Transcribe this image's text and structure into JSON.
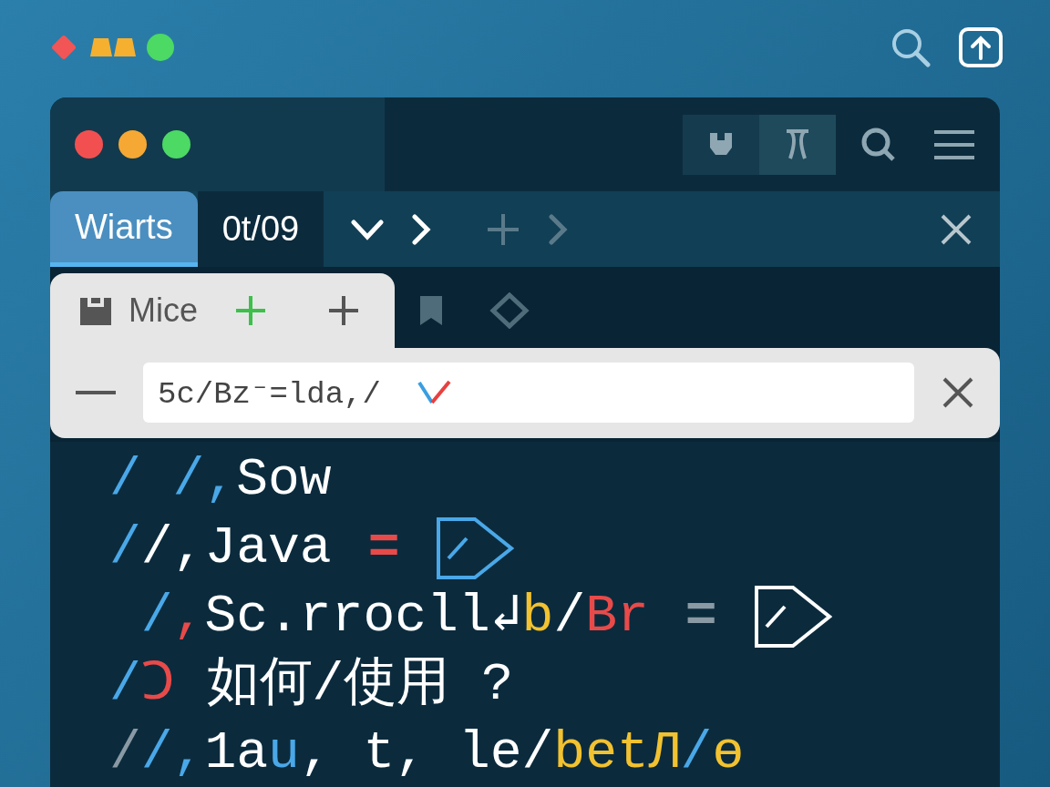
{
  "toolbar_buttons": [
    {
      "selected": false
    },
    {
      "selected": true
    }
  ],
  "tabs": [
    {
      "label": "Wiarts",
      "selected": true
    },
    {
      "label": "0t/09",
      "selected": false
    }
  ],
  "find_panel": {
    "tab_label": "Mice",
    "value": "5c/Bz⁻=lda,/"
  },
  "code_lines": [
    {
      "segments": [
        {
          "text": "/ /,",
          "color": "#4aa8e8"
        },
        {
          "text": "Sow",
          "color": "#ffffff"
        }
      ]
    },
    {
      "segments": [
        {
          "text": "/",
          "color": "#4aa8e8"
        },
        {
          "text": "/,",
          "color": "#ffffff"
        },
        {
          "text": "Java",
          "color": "#ffffff"
        }
      ],
      "equals": {
        "text": "=",
        "color": "#e84a4a"
      },
      "marker": {
        "color": "#4aa8e8"
      }
    },
    {
      "segments": [
        {
          "text": " /",
          "color": "#4aa8e8"
        },
        {
          "text": ",",
          "color": "#e84a4a"
        },
        {
          "text": "Sc.rrocll↲",
          "color": "#ffffff"
        },
        {
          "text": "b",
          "color": "#f2c230"
        },
        {
          "text": "/",
          "color": "#ffffff"
        },
        {
          "text": "Br",
          "color": "#e84a4a"
        }
      ],
      "equals": {
        "text": "=",
        "color": "#8a9aa4"
      },
      "marker": {
        "color": "#ffffff"
      }
    },
    {
      "segments": [
        {
          "text": "/",
          "color": "#4aa8e8"
        },
        {
          "text": "Ↄ",
          "color": "#e84a4a"
        },
        {
          "text": " 如何/使用 ?",
          "color": "#ffffff"
        }
      ]
    },
    {
      "segments": [
        {
          "text": "/",
          "color": "#8a9aa4"
        },
        {
          "text": "/,",
          "color": "#4aa8e8"
        },
        {
          "text": "1a",
          "color": "#ffffff"
        },
        {
          "text": "u",
          "color": "#4aa8e8"
        },
        {
          "text": ", t, le/",
          "color": "#ffffff"
        },
        {
          "text": "betЛ",
          "color": "#f2c230"
        },
        {
          "text": "/",
          "color": "#4aa8e8"
        },
        {
          "text": "ɵ",
          "color": "#f2c230"
        }
      ]
    }
  ]
}
